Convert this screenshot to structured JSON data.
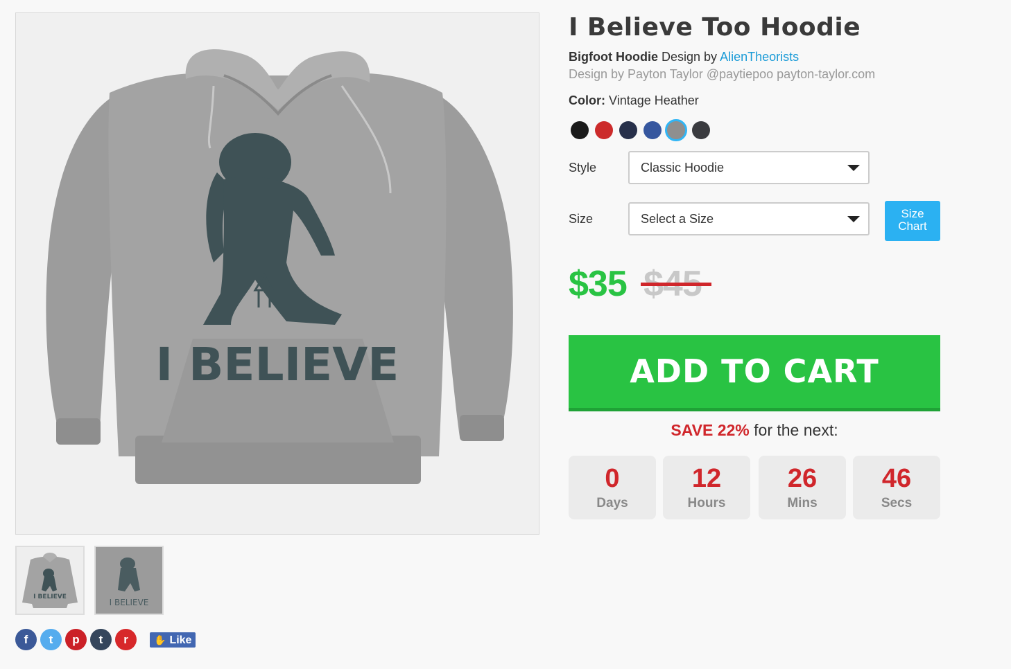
{
  "product": {
    "title": "I Believe Too Hoodie",
    "category": "Bigfoot Hoodie",
    "design_by_prefix": "Design by",
    "designer": "AlienTheorists",
    "credit": "Design by Payton Taylor @paytiepoo payton-taylor.com",
    "print_text": "I BELIEVE"
  },
  "color": {
    "label": "Color:",
    "value": "Vintage Heather",
    "swatches": [
      {
        "name": "black",
        "hex": "#1a1a1a"
      },
      {
        "name": "red",
        "hex": "#cc2b2b"
      },
      {
        "name": "navy",
        "hex": "#27304a"
      },
      {
        "name": "royal",
        "hex": "#36579f"
      },
      {
        "name": "vintage-heather",
        "hex": "#8f8f8f",
        "selected": true
      },
      {
        "name": "charcoal",
        "hex": "#3a3b3f"
      }
    ]
  },
  "style": {
    "label": "Style",
    "value": "Classic Hoodie"
  },
  "size": {
    "label": "Size",
    "value": "Select a Size",
    "chart_label_1": "Size",
    "chart_label_2": "Chart"
  },
  "price": {
    "current": "$35",
    "original": "$45"
  },
  "cart": {
    "label": "ADD TO CART"
  },
  "promo": {
    "highlight": "SAVE 22%",
    "rest": " for the next:"
  },
  "countdown": [
    {
      "value": "0",
      "label": "Days"
    },
    {
      "value": "12",
      "label": "Hours"
    },
    {
      "value": "26",
      "label": "Mins"
    },
    {
      "value": "46",
      "label": "Secs"
    }
  ],
  "social": {
    "facebook": "f",
    "twitter": "t",
    "pinterest": "p",
    "tumblr": "t",
    "reddit": "r",
    "like_label": "Like"
  }
}
